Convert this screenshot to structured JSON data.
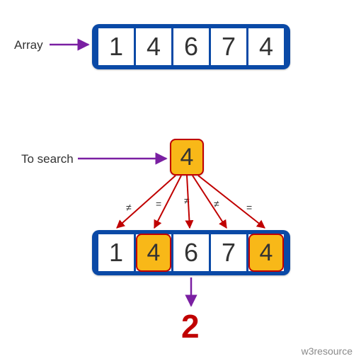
{
  "labels": {
    "array": "Array",
    "to_search": "To search"
  },
  "array1": {
    "values": [
      "1",
      "4",
      "6",
      "7",
      "4"
    ]
  },
  "search": {
    "value": "4"
  },
  "comparisons": [
    "≠",
    "=",
    "≠",
    "≠",
    "="
  ],
  "array2": {
    "values": [
      "1",
      "4",
      "6",
      "7",
      "4"
    ],
    "highlighted_indices": [
      1,
      4
    ]
  },
  "result": "2",
  "watermark": "w3resource",
  "colors": {
    "blue": "#0a49a6",
    "orange": "#f8b818",
    "red": "#c00000",
    "purple_arrow": "#7a1fa2"
  }
}
